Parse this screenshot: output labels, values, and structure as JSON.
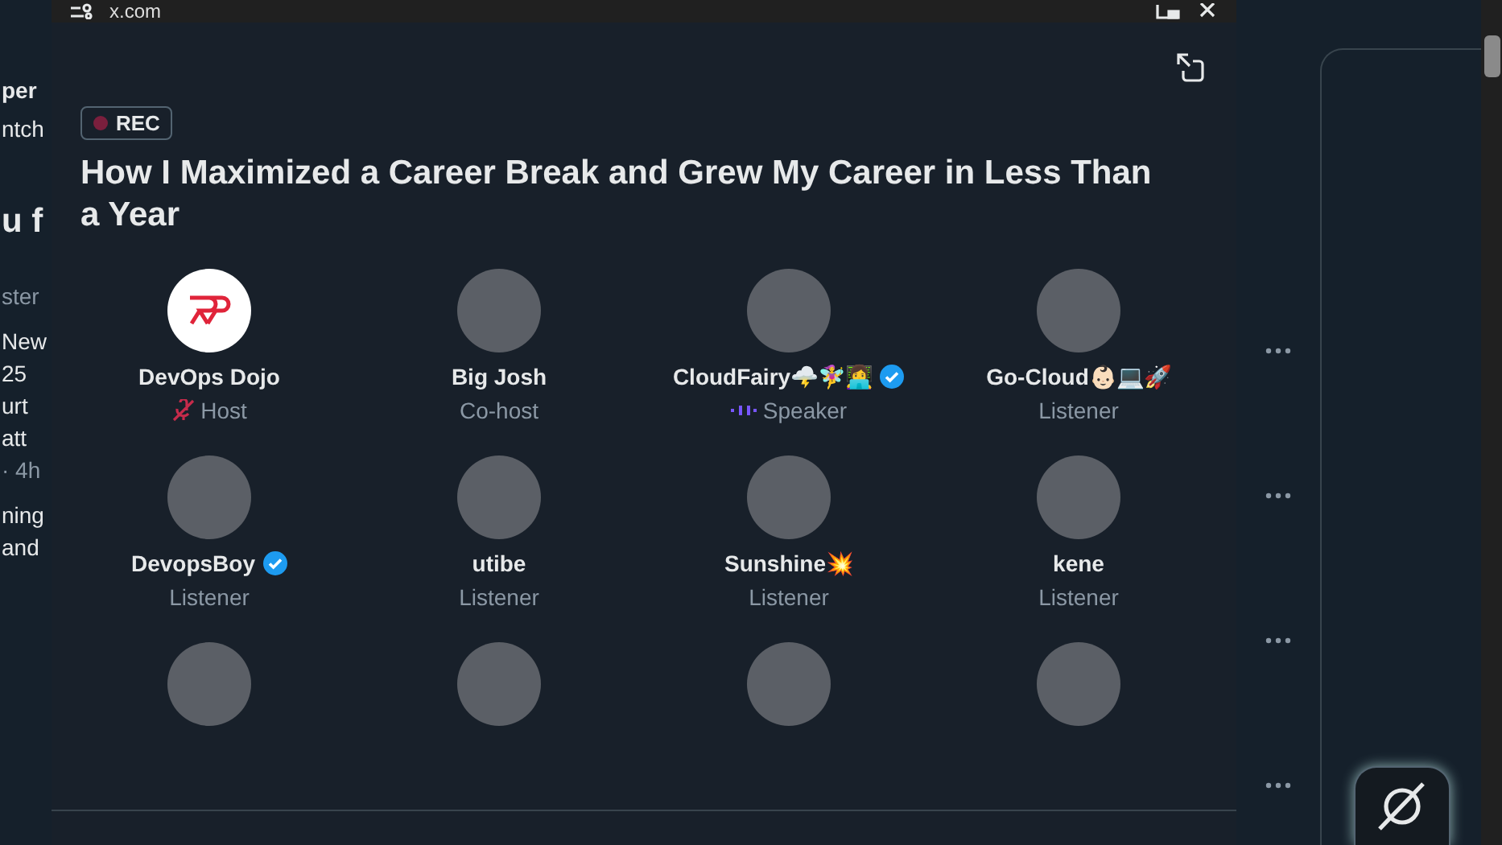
{
  "background_feed": {
    "left_texts": [
      {
        "text": "per",
        "kind": "bold"
      },
      {
        "text": "ntch",
        "kind": "plain"
      },
      {
        "text": "u f",
        "kind": "heading"
      },
      {
        "text": "ster",
        "kind": "muted"
      },
      {
        "text": "New",
        "kind": "plain"
      },
      {
        "text": "25",
        "kind": "plain"
      },
      {
        "text": "urt",
        "kind": "plain"
      },
      {
        "text": "att",
        "kind": "plain"
      },
      {
        "text": "· 4h",
        "kind": "muted"
      },
      {
        "text": "ning",
        "kind": "plain"
      },
      {
        "text": "and",
        "kind": "plain"
      }
    ]
  },
  "window": {
    "title": "x.com"
  },
  "space": {
    "recording": true,
    "rec_label": "REC",
    "title": "How I Maximized a Career Break and Grew My Career in Less Than a Year",
    "participants": [
      {
        "name": "DevOps Dojo",
        "role": "Host",
        "role_icon": {
          "kind": "muted-mic"
        },
        "verified": false,
        "avatar": {
          "kind": "logo"
        }
      },
      {
        "name": "Big Josh",
        "role": "Co-host",
        "verified": false,
        "avatar": {
          "kind": "photo"
        }
      },
      {
        "name": "CloudFairy🌩️🧚‍♀️👩‍💻",
        "role": "Speaker",
        "role_icon": {
          "kind": "speaking"
        },
        "verified": true,
        "avatar": {
          "kind": "photo"
        }
      },
      {
        "name": "Go-Cloud👶🏻💻🚀",
        "role": "Listener",
        "verified": false,
        "avatar": {
          "kind": "photo"
        }
      },
      {
        "name": "DevopsBoy",
        "role": "Listener",
        "verified": true,
        "avatar": {
          "kind": "photo"
        }
      },
      {
        "name": "utibe",
        "role": "Listener",
        "verified": false,
        "avatar": {
          "kind": "photo"
        }
      },
      {
        "name": "Sunshine💥",
        "role": "Listener",
        "verified": false,
        "avatar": {
          "kind": "photo"
        }
      },
      {
        "name": "kene",
        "role": "Listener",
        "verified": false,
        "avatar": {
          "kind": "photo"
        }
      },
      {
        "avatar": {
          "kind": "photo"
        }
      },
      {
        "avatar": {
          "kind": "photo"
        }
      },
      {
        "avatar": {
          "kind": "photo"
        }
      },
      {
        "avatar": {
          "kind": "photo"
        }
      }
    ]
  }
}
